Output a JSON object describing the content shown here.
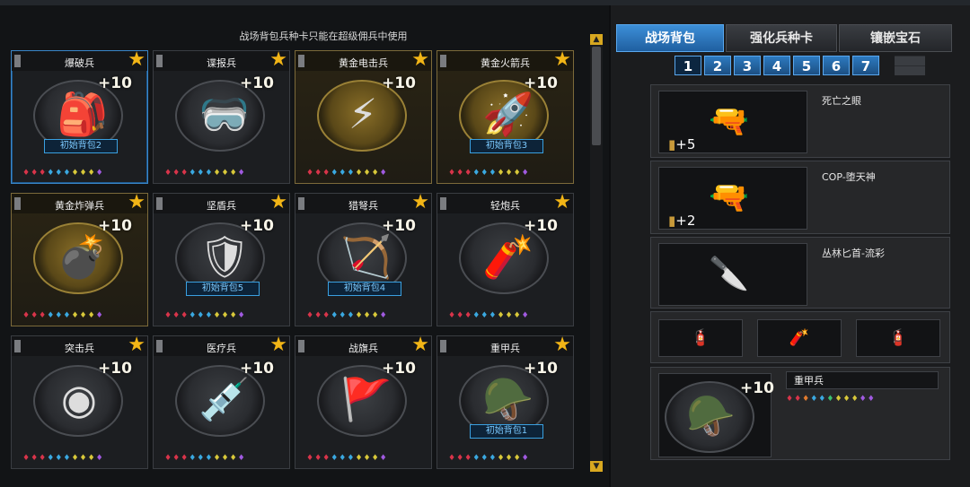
{
  "notice": "战场背包兵种卡只能在超级佣兵中使用",
  "cards": [
    {
      "name": "爆破兵",
      "plus": "+10",
      "badge": "初始背包2",
      "icon": "explosive-kit-icon",
      "glyph": "🎒",
      "gold": false,
      "selected": true
    },
    {
      "name": "谍报兵",
      "plus": "+10",
      "badge": "",
      "icon": "spy-mask-icon",
      "glyph": "🥽",
      "gold": false
    },
    {
      "name": "黄金电击兵",
      "plus": "+10",
      "badge": "",
      "icon": "lightning-gauntlet-icon",
      "glyph": "⚡",
      "gold": true
    },
    {
      "name": "黄金火箭兵",
      "plus": "+10",
      "badge": "初始背包3",
      "icon": "rocket-launcher-icon",
      "glyph": "🚀",
      "gold": true
    },
    {
      "name": "黄金炸弹兵",
      "plus": "+10",
      "badge": "",
      "icon": "gold-bomb-icon",
      "glyph": "💣",
      "gold": true
    },
    {
      "name": "坚盾兵",
      "plus": "+10",
      "badge": "初始背包5",
      "icon": "riot-shield-icon",
      "glyph": "🛡",
      "gold": false
    },
    {
      "name": "猎弩兵",
      "plus": "+10",
      "badge": "初始背包4",
      "icon": "crossbow-icon",
      "glyph": "🏹",
      "gold": false
    },
    {
      "name": "轻炮兵",
      "plus": "+10",
      "badge": "",
      "icon": "mortar-icon",
      "glyph": "🧨",
      "gold": false
    },
    {
      "name": "突击兵",
      "plus": "+10",
      "badge": "",
      "icon": "assault-module-icon",
      "glyph": "◉",
      "gold": false
    },
    {
      "name": "医疗兵",
      "plus": "+10",
      "badge": "",
      "icon": "medkit-icon",
      "glyph": "💉",
      "gold": false
    },
    {
      "name": "战旗兵",
      "plus": "+10",
      "badge": "",
      "icon": "war-banner-icon",
      "glyph": "🚩",
      "gold": false
    },
    {
      "name": "重甲兵",
      "plus": "+10",
      "badge": "初始背包1",
      "icon": "heavy-armor-icon",
      "glyph": "🪖",
      "gold": false
    }
  ],
  "tabs": [
    "战场背包",
    "强化兵种卡",
    "镶嵌宝石"
  ],
  "pages": [
    "1",
    "2",
    "3",
    "4",
    "5",
    "6",
    "7"
  ],
  "weapons": [
    {
      "name": "死亡之眼",
      "ammo": "+5",
      "icon": "smg-icon",
      "glyph": "🔫"
    },
    {
      "name": "COP-堕天神",
      "ammo": "+2",
      "icon": "pistol-icon",
      "glyph": "🔫"
    },
    {
      "name": "丛林匕首-流彩",
      "ammo": "",
      "icon": "knife-icon",
      "glyph": "🔪"
    }
  ],
  "grenades": [
    {
      "icon": "grenade-icon-1",
      "glyph": "🧯"
    },
    {
      "icon": "grenade-icon-2",
      "glyph": "🧨"
    },
    {
      "icon": "grenade-icon-3",
      "glyph": "🧯"
    }
  ],
  "selected": {
    "name": "重甲兵",
    "plus": "+10",
    "icon": "heavy-armor-icon"
  },
  "gems": "♦♦♦♦♦♦♦♦♦♦♦"
}
